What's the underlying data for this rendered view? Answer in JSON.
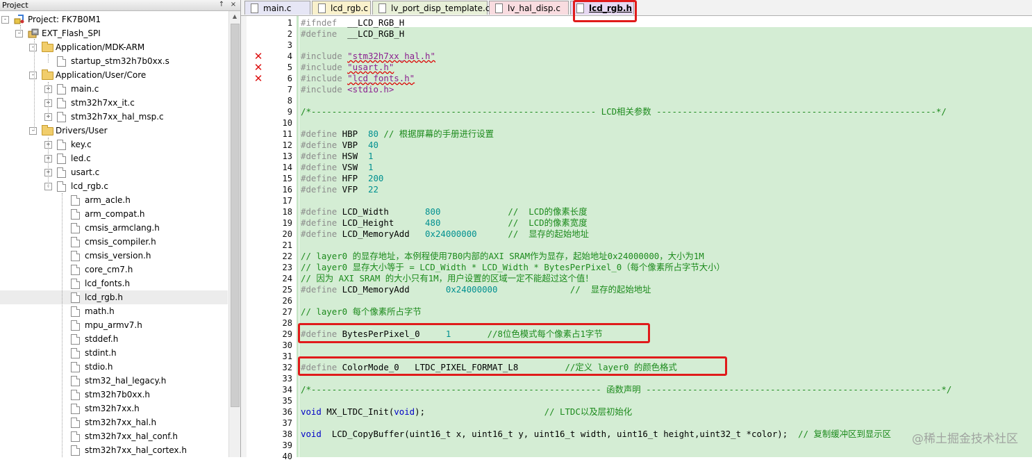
{
  "project_panel": {
    "title": "Project",
    "pin_glyph": "↑",
    "close_glyph": "×",
    "root": "Project: FK7B0M1",
    "target": "EXT_Flash_SPI",
    "groups": [
      {
        "label": "Application/MDK-ARM",
        "files": [
          "startup_stm32h7b0xx.s"
        ]
      },
      {
        "label": "Application/User/Core",
        "files": [
          "main.c",
          "stm32h7xx_it.c",
          "stm32h7xx_hal_msp.c"
        ]
      },
      {
        "label": "Drivers/User",
        "files": [
          "key.c",
          "led.c",
          "usart.c",
          "lcd_rgb.c"
        ]
      }
    ],
    "headers": [
      "arm_acle.h",
      "arm_compat.h",
      "cmsis_armclang.h",
      "cmsis_compiler.h",
      "cmsis_version.h",
      "core_cm7.h",
      "lcd_fonts.h",
      "lcd_rgb.h",
      "math.h",
      "mpu_armv7.h",
      "stddef.h",
      "stdint.h",
      "stdio.h",
      "stm32_hal_legacy.h",
      "stm32h7b0xx.h",
      "stm32h7xx.h",
      "stm32h7xx_hal.h",
      "stm32h7xx_hal_conf.h",
      "stm32h7xx_hal_cortex.h"
    ],
    "selected": "lcd_rgb.h"
  },
  "tabs": [
    {
      "label": "main.c",
      "color": "#e6e6f5"
    },
    {
      "label": "lcd_rgb.c",
      "color": "#f9f1cc"
    },
    {
      "label": "lv_port_disp_template.c*",
      "color": "#e8f0d8"
    },
    {
      "label": "lv_hal_disp.c",
      "color": "#f9dce0"
    },
    {
      "label": "lcd_rgb.h",
      "color": "#e6d8f2",
      "active": true
    }
  ],
  "error_lines": [
    4,
    5,
    6
  ],
  "code_lines": [
    [
      {
        "t": "#ifndef",
        "c": "pp"
      },
      {
        "t": "  __LCD_RGB_H"
      }
    ],
    [
      {
        "t": "#define",
        "c": "pp"
      },
      {
        "t": "  __LCD_RGB_H"
      }
    ],
    [],
    [
      {
        "t": "#include",
        "c": "pp"
      },
      {
        "t": " "
      },
      {
        "t": "\"stm32h7xx_hal.h\"",
        "c": "str"
      }
    ],
    [
      {
        "t": "#include",
        "c": "pp"
      },
      {
        "t": " "
      },
      {
        "t": "\"usart.h\"",
        "c": "str"
      }
    ],
    [
      {
        "t": "#include",
        "c": "pp"
      },
      {
        "t": " "
      },
      {
        "t": "\"lcd_fonts.h\"",
        "c": "str"
      }
    ],
    [
      {
        "t": "#include",
        "c": "pp"
      },
      {
        "t": " "
      },
      {
        "t": "<stdio.h>",
        "c": "str"
      }
    ],
    [],
    [
      {
        "t": "/*------------------------------------------------------- LCD相关参数 ------------------------------------------------------*/",
        "c": "cm"
      }
    ],
    [],
    [
      {
        "t": "#define",
        "c": "pp"
      },
      {
        "t": " HBP  "
      },
      {
        "t": "80",
        "c": "num"
      },
      {
        "t": " // 根据屏幕的手册进行设置",
        "c": "cm"
      }
    ],
    [
      {
        "t": "#define",
        "c": "pp"
      },
      {
        "t": " VBP  "
      },
      {
        "t": "40",
        "c": "num"
      }
    ],
    [
      {
        "t": "#define",
        "c": "pp"
      },
      {
        "t": " HSW  "
      },
      {
        "t": "1",
        "c": "num"
      }
    ],
    [
      {
        "t": "#define",
        "c": "pp"
      },
      {
        "t": " VSW  "
      },
      {
        "t": "1",
        "c": "num"
      }
    ],
    [
      {
        "t": "#define",
        "c": "pp"
      },
      {
        "t": " HFP  "
      },
      {
        "t": "200",
        "c": "num"
      }
    ],
    [
      {
        "t": "#define",
        "c": "pp"
      },
      {
        "t": " VFP  "
      },
      {
        "t": "22",
        "c": "num"
      }
    ],
    [],
    [
      {
        "t": "#define",
        "c": "pp"
      },
      {
        "t": " LCD_Width       "
      },
      {
        "t": "800",
        "c": "num"
      },
      {
        "t": "             "
      },
      {
        "t": "//  LCD的像素长度",
        "c": "cm"
      }
    ],
    [
      {
        "t": "#define",
        "c": "pp"
      },
      {
        "t": " LCD_Height      "
      },
      {
        "t": "480",
        "c": "num"
      },
      {
        "t": "             "
      },
      {
        "t": "//  LCD的像素宽度",
        "c": "cm"
      }
    ],
    [
      {
        "t": "#define",
        "c": "pp"
      },
      {
        "t": " LCD_MemoryAdd   "
      },
      {
        "t": "0x24000000",
        "c": "num"
      },
      {
        "t": "      "
      },
      {
        "t": "//  显存的起始地址",
        "c": "cm"
      }
    ],
    [],
    [
      {
        "t": "// layer0 的显存地址，本例程使用7B0内部的AXI SRAM作为显存，起始地址0x24000000，大小为1M",
        "c": "cm"
      }
    ],
    [
      {
        "t": "// layer0 显存大小等于 = LCD_Width * LCD_Width * BytesPerPixel_0（每个像素所占字节大小）",
        "c": "cm"
      }
    ],
    [
      {
        "t": "// 因为 AXI SRAM 的大小只有1M，用户设置的区域一定不能超过这个值！",
        "c": "cm"
      }
    ],
    [
      {
        "t": "#define",
        "c": "pp"
      },
      {
        "t": " LCD_MemoryAdd       "
      },
      {
        "t": "0x24000000",
        "c": "num"
      },
      {
        "t": "              "
      },
      {
        "t": "//  显存的起始地址",
        "c": "cm"
      }
    ],
    [],
    [
      {
        "t": "// layer0 每个像素所占字节",
        "c": "cm"
      }
    ],
    [],
    [
      {
        "t": "#define",
        "c": "pp"
      },
      {
        "t": " BytesPerPixel_0     "
      },
      {
        "t": "1",
        "c": "num"
      },
      {
        "t": "       "
      },
      {
        "t": "//8位色模式每个像素占1字节",
        "c": "cm"
      }
    ],
    [],
    [],
    [
      {
        "t": "#define",
        "c": "pp"
      },
      {
        "t": " ColorMode_0   LTDC_PIXEL_FORMAT_L8         "
      },
      {
        "t": "//定义 layer0 的颜色格式",
        "c": "cm"
      }
    ],
    [],
    [
      {
        "t": "/*-------------------------------------------------------- 函数声明 ---------------------------------------------------------*/",
        "c": "cm"
      }
    ],
    [],
    [
      {
        "t": "void",
        "c": "kw"
      },
      {
        "t": " MX_LTDC_Init("
      },
      {
        "t": "void",
        "c": "kw"
      },
      {
        "t": ");                       "
      },
      {
        "t": "// LTDC以及层初始化",
        "c": "cm"
      }
    ],
    [],
    [
      {
        "t": "void",
        "c": "kw"
      },
      {
        "t": "  LCD_CopyBuffer(uint16_t x, uint16_t y, uint16_t width, uint16_t height,uint32_t *color);  "
      },
      {
        "t": "// 复制缓冲区到显示区",
        "c": "cm"
      }
    ],
    [],
    []
  ],
  "watermark": "@稀土掘金技术社区"
}
